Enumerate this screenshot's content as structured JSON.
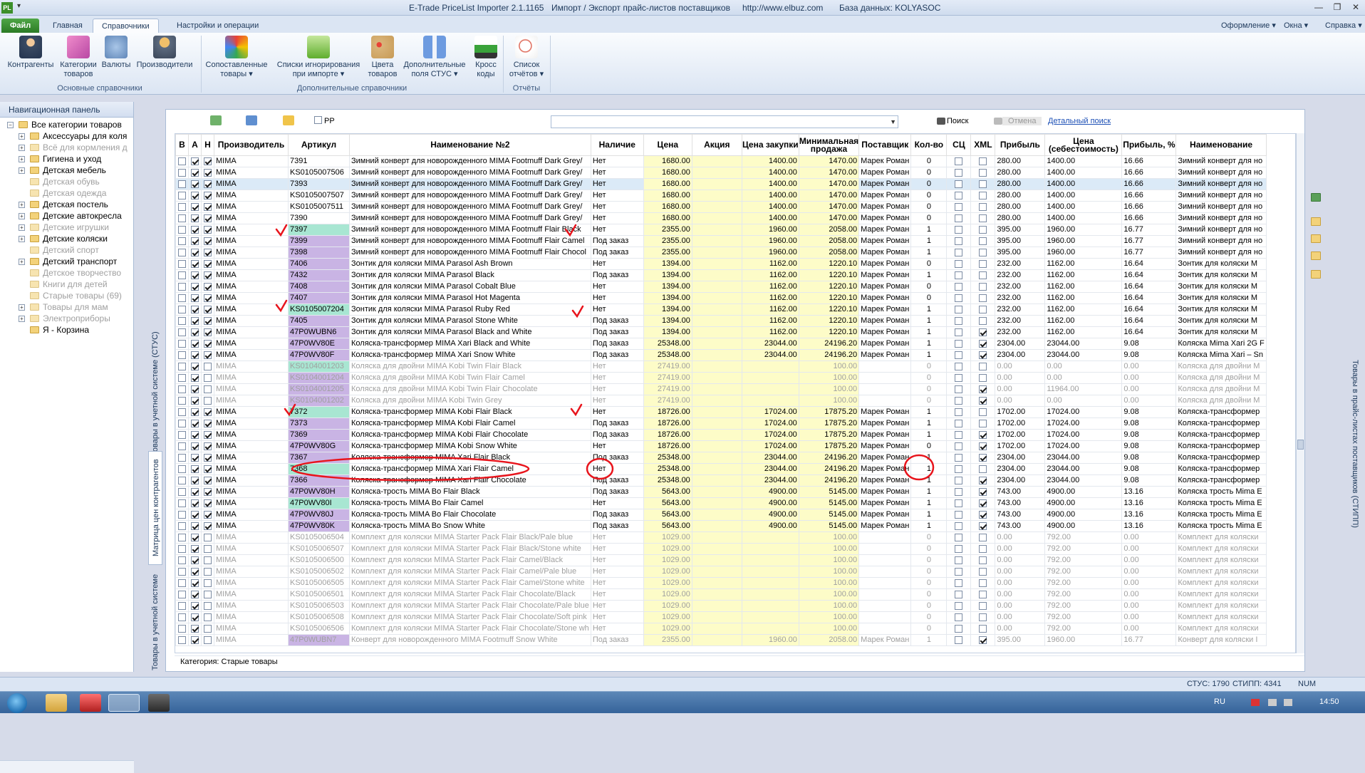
{
  "window": {
    "title": "E-Trade PriceList Importer 2.1.1165",
    "subtitle": "Импорт / Экспорт прайс-листов поставщиков",
    "url": "http://www.elbuz.com",
    "database": "База данных: KOLYASOC"
  },
  "ribbon_tabs": [
    "Файл",
    "Главная",
    "Справочники",
    "Настройки и операции"
  ],
  "ribbon_menus": [
    "Оформление",
    "Окна",
    "Справка"
  ],
  "ribbon_buttons": [
    {
      "label1": "Контрагенты",
      "label2": ""
    },
    {
      "label1": "Категории",
      "label2": "товаров"
    },
    {
      "label1": "Валюты",
      "label2": ""
    },
    {
      "label1": "Производители",
      "label2": ""
    },
    {
      "label1": "Сопоставленные",
      "label2": "товары"
    },
    {
      "label1": "Списки игнорирования",
      "label2": "при импорте"
    },
    {
      "label1": "Цвета",
      "label2": "товаров"
    },
    {
      "label1": "Дополнительные",
      "label2": "поля СТУС"
    },
    {
      "label1": "Кросс",
      "label2": "коды"
    },
    {
      "label1": "Список",
      "label2": "отчётов"
    }
  ],
  "ribbon_groups": [
    "Основные справочники",
    "Дополнительные справочники",
    "Отчёты"
  ],
  "nav": {
    "title": "Навигационная панель",
    "root": "Все категории товаров",
    "items": [
      {
        "label": "Аксессуары для коля",
        "dim": false,
        "exp": true
      },
      {
        "label": "Всё для кормления д",
        "dim": true,
        "exp": true
      },
      {
        "label": "Гигиена и уход",
        "dim": false,
        "exp": true
      },
      {
        "label": "Детская мебель",
        "dim": false,
        "exp": true
      },
      {
        "label": "Детская обувь",
        "dim": true,
        "exp": false
      },
      {
        "label": "Детская одежда",
        "dim": true,
        "exp": false
      },
      {
        "label": "Детская постель",
        "dim": false,
        "exp": true
      },
      {
        "label": "Детские автокресла",
        "dim": false,
        "exp": true
      },
      {
        "label": "Детские игрушки",
        "dim": true,
        "exp": true
      },
      {
        "label": "Детские коляски",
        "dim": false,
        "exp": true
      },
      {
        "label": "Детский спорт",
        "dim": true,
        "exp": false
      },
      {
        "label": "Детский транспорт",
        "dim": false,
        "exp": true
      },
      {
        "label": "Детское творчество",
        "dim": true,
        "exp": false
      },
      {
        "label": "Книги для детей",
        "dim": true,
        "exp": false
      },
      {
        "label": "Старые товары (69)",
        "dim": true,
        "exp": false
      },
      {
        "label": "Товары для мам",
        "dim": true,
        "exp": true
      },
      {
        "label": "Электроприборы",
        "dim": true,
        "exp": true
      },
      {
        "label": "Я - Корзина",
        "dim": false,
        "exp": false
      }
    ]
  },
  "side_tabs": [
    "Товары в учетной системе (СТУС)",
    "Матрица цен контрагентов",
    "Товары в учетной системе"
  ],
  "right_tab": "Товары в прайс-листах поставщиков (СТИПП)",
  "toolbar": {
    "pp": "PP",
    "search": "Поиск",
    "cancel": "Отмена",
    "advanced": "Детальный поиск"
  },
  "columns": [
    "В",
    "А",
    "Н",
    "Производитель",
    "Артикул",
    "Наименование №2",
    "Наличие",
    "Цена",
    "Акция",
    "Цена закупки",
    "Минимальная продажа",
    "Поставщик",
    "Кол-во",
    "СЦ",
    "XML",
    "Прибыль",
    "Цена (себестоимость)",
    "Прибыль, %",
    "Наименование"
  ],
  "rows": [
    [
      "MIMA",
      "7391",
      "",
      "Зимний конверт для новорожденного MIMA Footmuff Dark Grey/",
      "Нет",
      "1680.00",
      "1400.00",
      "1470.00",
      "Марек Роман",
      "0",
      false,
      "280.00",
      "1400.00",
      "16.66",
      "Зимний конверт для но",
      "",
      "n"
    ],
    [
      "MIMA",
      "KS0105007506",
      "",
      "Зимний конверт для новорожденного MIMA Footmuff Dark Grey/",
      "Нет",
      "1680.00",
      "1400.00",
      "1470.00",
      "Марек Роман",
      "0",
      false,
      "280.00",
      "1400.00",
      "16.66",
      "Зимний конверт для но",
      "",
      "n"
    ],
    [
      "MIMA",
      "7393",
      "",
      "Зимний конверт для новорожденного MIMA Footmuff Dark Grey/",
      "Нет",
      "1680.00",
      "1400.00",
      "1470.00",
      "Марек Роман",
      "0",
      false,
      "280.00",
      "1400.00",
      "16.66",
      "Зимний конверт для но",
      "",
      "s"
    ],
    [
      "MIMA",
      "KS0105007507",
      "",
      "Зимний конверт для новорожденного MIMA Footmuff Dark Grey/",
      "Нет",
      "1680.00",
      "1400.00",
      "1470.00",
      "Марек Роман",
      "0",
      false,
      "280.00",
      "1400.00",
      "16.66",
      "Зимний конверт для но",
      "",
      "n"
    ],
    [
      "MIMA",
      "KS0105007511",
      "",
      "Зимний конверт для новорожденного MIMA Footmuff Dark Grey/",
      "Нет",
      "1680.00",
      "1400.00",
      "1470.00",
      "Марек Роман",
      "0",
      false,
      "280.00",
      "1400.00",
      "16.66",
      "Зимний конверт для но",
      "",
      "n"
    ],
    [
      "MIMA",
      "7390",
      "",
      "Зимний конверт для новорожденного MIMA Footmuff Dark Grey/",
      "Нет",
      "1680.00",
      "1400.00",
      "1470.00",
      "Марек Роман",
      "0",
      false,
      "280.00",
      "1400.00",
      "16.66",
      "Зимний конверт для но",
      "",
      "n"
    ],
    [
      "MIMA",
      "7397",
      "t",
      "Зимний конверт для новорожденного MIMA Footmuff Flair Black",
      "Нет",
      "2355.00",
      "1960.00",
      "2058.00",
      "Марек Роман",
      "1",
      false,
      "395.00",
      "1960.00",
      "16.77",
      "Зимний конверт для но",
      "",
      "n"
    ],
    [
      "MIMA",
      "7399",
      "p",
      "Зимний конверт для новорожденного MIMA Footmuff Flair Camel",
      "Под заказ",
      "2355.00",
      "1960.00",
      "2058.00",
      "Марек Роман",
      "1",
      false,
      "395.00",
      "1960.00",
      "16.77",
      "Зимний конверт для но",
      "",
      "n"
    ],
    [
      "MIMA",
      "7398",
      "p",
      "Зимний конверт для новорожденного MIMA Footmuff Flair Chocol",
      "Под заказ",
      "2355.00",
      "1960.00",
      "2058.00",
      "Марек Роман",
      "1",
      false,
      "395.00",
      "1960.00",
      "16.77",
      "Зимний конверт для но",
      "",
      "n"
    ],
    [
      "MIMA",
      "7406",
      "p",
      "Зонтик для коляски MIMA Parasol Ash Brown",
      "Нет",
      "1394.00",
      "1162.00",
      "1220.10",
      "Марек Роман",
      "0",
      false,
      "232.00",
      "1162.00",
      "16.64",
      "Зонтик для коляски M",
      "",
      "n"
    ],
    [
      "MIMA",
      "7432",
      "p",
      "Зонтик для коляски MIMA Parasol Black",
      "Под заказ",
      "1394.00",
      "1162.00",
      "1220.10",
      "Марек Роман",
      "1",
      false,
      "232.00",
      "1162.00",
      "16.64",
      "Зонтик для коляски M",
      "",
      "n"
    ],
    [
      "MIMA",
      "7408",
      "p",
      "Зонтик для коляски MIMA Parasol Cobalt Blue",
      "Нет",
      "1394.00",
      "1162.00",
      "1220.10",
      "Марек Роман",
      "0",
      false,
      "232.00",
      "1162.00",
      "16.64",
      "Зонтик для коляски M",
      "",
      "n"
    ],
    [
      "MIMA",
      "7407",
      "p",
      "Зонтик для коляски MIMA Parasol Hot Magenta",
      "Нет",
      "1394.00",
      "1162.00",
      "1220.10",
      "Марек Роман",
      "0",
      false,
      "232.00",
      "1162.00",
      "16.64",
      "Зонтик для коляски M",
      "",
      "n"
    ],
    [
      "MIMA",
      "KS0105007204",
      "t",
      "Зонтик для коляски MIMA Parasol Ruby Red",
      "Нет",
      "1394.00",
      "1162.00",
      "1220.10",
      "Марек Роман",
      "1",
      false,
      "232.00",
      "1162.00",
      "16.64",
      "Зонтик для коляски M",
      "",
      "n"
    ],
    [
      "MIMA",
      "7405",
      "p",
      "Зонтик для коляски MIMA Parasol Stone White",
      "Под заказ",
      "1394.00",
      "1162.00",
      "1220.10",
      "Марек Роман",
      "1",
      false,
      "232.00",
      "1162.00",
      "16.64",
      "Зонтик для коляски M",
      "",
      "n"
    ],
    [
      "MIMA",
      "47P0WUBN6",
      "p",
      "Зонтик для коляски  MIMA Parasol Black and White",
      "Под заказ",
      "1394.00",
      "1162.00",
      "1220.10",
      "Марек Роман",
      "1",
      true,
      "232.00",
      "1162.00",
      "16.64",
      "Зонтик для коляски M",
      "",
      "n"
    ],
    [
      "MIMA",
      "47P0WV80E",
      "p",
      "Коляска-трансформер MIMA Xari Black and White",
      "Под заказ",
      "25348.00",
      "23044.00",
      "24196.20",
      "Марек Роман",
      "1",
      true,
      "2304.00",
      "23044.00",
      "9.08",
      "Коляска Mima Xari 2G F",
      "",
      "n"
    ],
    [
      "MIMA",
      "47P0WV80F",
      "p",
      "Коляска-трансформер MIMA Xari Snow White",
      "Под заказ",
      "25348.00",
      "23044.00",
      "24196.20",
      "Марек Роман",
      "1",
      true,
      "2304.00",
      "23044.00",
      "9.08",
      "Коляска Mima Xari – Sn",
      "",
      "n"
    ],
    [
      "MIMA",
      "KS0104001203",
      "t",
      "Коляска для двойни MIMA Kobi Twin Flair Black",
      "Нет",
      "27419.00",
      "",
      "100.00",
      "",
      "0",
      false,
      "0.00",
      "0.00",
      "0.00",
      "Коляска для двойни M",
      "",
      "d"
    ],
    [
      "MIMA",
      "KS0104001204",
      "p",
      "Коляска для двойни MIMA Kobi Twin Flair Camel",
      "Нет",
      "27419.00",
      "",
      "100.00",
      "",
      "0",
      false,
      "0.00",
      "0.00",
      "0.00",
      "Коляска для двойни M",
      "",
      "d"
    ],
    [
      "MIMA",
      "KS0104001205",
      "p",
      "Коляска для двойни MIMA Kobi Twin Flair Chocolate",
      "Нет",
      "27419.00",
      "",
      "100.00",
      "",
      "0",
      true,
      "0.00",
      "11964.00",
      "0.00",
      "Коляска для двойни M",
      "",
      "d"
    ],
    [
      "MIMA",
      "KS0104001202",
      "p",
      "Коляска для двойни MIMA Kobi Twin Grey",
      "Нет",
      "27419.00",
      "",
      "100.00",
      "",
      "0",
      true,
      "0.00",
      "0.00",
      "0.00",
      "Коляска для двойни M",
      "",
      "d"
    ],
    [
      "MIMA",
      "7372",
      "t",
      "Коляска-трансформер MIMA Kobi Flair Black",
      "Нет",
      "18726.00",
      "17024.00",
      "17875.20",
      "Марек Роман",
      "1",
      false,
      "1702.00",
      "17024.00",
      "9.08",
      "Коляска-трансформер",
      "",
      "n"
    ],
    [
      "MIMA",
      "7373",
      "p",
      "Коляска-трансформер MIMA Kobi Flair Camel",
      "Под заказ",
      "18726.00",
      "17024.00",
      "17875.20",
      "Марек Роман",
      "1",
      false,
      "1702.00",
      "17024.00",
      "9.08",
      "Коляска-трансформер",
      "",
      "n"
    ],
    [
      "MIMA",
      "7369",
      "p",
      "Коляска-трансформер MIMA Kobi Flair Chocolate",
      "Под заказ",
      "18726.00",
      "17024.00",
      "17875.20",
      "Марек Роман",
      "1",
      true,
      "1702.00",
      "17024.00",
      "9.08",
      "Коляска-трансформер",
      "",
      "n"
    ],
    [
      "MIMA",
      "47P0WV80G",
      "p",
      "Коляска-трансформер MIMA Kobi Snow White",
      "Нет",
      "18726.00",
      "17024.00",
      "17875.20",
      "Марек Роман",
      "0",
      true,
      "1702.00",
      "17024.00",
      "9.08",
      "Коляска-трансформер",
      "",
      "n"
    ],
    [
      "MIMA",
      "7367",
      "p",
      "Коляска-трансформер MIMA Xari Flair Black",
      "Под заказ",
      "25348.00",
      "23044.00",
      "24196.20",
      "Марек Роман",
      "1",
      true,
      "2304.00",
      "23044.00",
      "9.08",
      "Коляска-трансформер",
      "",
      "n"
    ],
    [
      "MIMA",
      "7368",
      "t",
      "Коляска-трансформер MIMA Xari Flair Camel",
      "Нет",
      "25348.00",
      "23044.00",
      "24196.20",
      "Марек Роман",
      "1",
      false,
      "2304.00",
      "23044.00",
      "9.08",
      "Коляска-трансформер",
      "",
      "n"
    ],
    [
      "MIMA",
      "7366",
      "p",
      "Коляска-трансформер MIMA Xari Flair Chocolate",
      "Под заказ",
      "25348.00",
      "23044.00",
      "24196.20",
      "Марек Роман",
      "1",
      true,
      "2304.00",
      "23044.00",
      "9.08",
      "Коляска-трансформер",
      "",
      "n"
    ],
    [
      "MIMA",
      "47P0WV80H",
      "p",
      "Коляска-трость MIMA Bo Flair Black",
      "Под заказ",
      "5643.00",
      "4900.00",
      "5145.00",
      "Марек Роман",
      "1",
      true,
      "743.00",
      "4900.00",
      "13.16",
      "Коляска трость Mima E",
      "",
      "n"
    ],
    [
      "MIMA",
      "47P0WV80I",
      "t",
      "Коляска-трость MIMA Bo Flair Camel",
      "Нет",
      "5643.00",
      "4900.00",
      "5145.00",
      "Марек Роман",
      "1",
      true,
      "743.00",
      "4900.00",
      "13.16",
      "Коляска трость Mima E",
      "",
      "n"
    ],
    [
      "MIMA",
      "47P0WV80J",
      "p",
      "Коляска-трость MIMA Bo Flair Chocolate",
      "Под заказ",
      "5643.00",
      "4900.00",
      "5145.00",
      "Марек Роман",
      "1",
      true,
      "743.00",
      "4900.00",
      "13.16",
      "Коляска трость Mima E",
      "",
      "n"
    ],
    [
      "MIMA",
      "47P0WV80K",
      "p",
      "Коляска-трость MIMA Bo Snow White",
      "Под заказ",
      "5643.00",
      "4900.00",
      "5145.00",
      "Марек Роман",
      "1",
      true,
      "743.00",
      "4900.00",
      "13.16",
      "Коляска трость Mima E",
      "",
      "n"
    ],
    [
      "MIMA",
      "KS0105006504",
      "",
      "Комплект для коляски MIMA Starter Pack Flair Black/Pale blue",
      "Нет",
      "1029.00",
      "",
      "100.00",
      "",
      "0",
      false,
      "0.00",
      "792.00",
      "0.00",
      "Комплект для коляски",
      "",
      "d"
    ],
    [
      "MIMA",
      "KS0105006507",
      "",
      "Комплект для коляски MIMA Starter Pack Flair Black/Stone white",
      "Нет",
      "1029.00",
      "",
      "100.00",
      "",
      "0",
      false,
      "0.00",
      "792.00",
      "0.00",
      "Комплект для коляски",
      "",
      "d"
    ],
    [
      "MIMA",
      "KS0105006500",
      "",
      "Комплект для коляски MIMA Starter Pack Flair Camel/Black",
      "Нет",
      "1029.00",
      "",
      "100.00",
      "",
      "0",
      false,
      "0.00",
      "792.00",
      "0.00",
      "Комплект для коляски",
      "",
      "d"
    ],
    [
      "MIMA",
      "KS0105006502",
      "",
      "Комплект для коляски MIMA Starter Pack Flair Camel/Pale blue",
      "Нет",
      "1029.00",
      "",
      "100.00",
      "",
      "0",
      false,
      "0.00",
      "792.00",
      "0.00",
      "Комплект для коляски",
      "",
      "d"
    ],
    [
      "MIMA",
      "KS0105006505",
      "",
      "Комплект для коляски MIMA Starter Pack Flair Camel/Stone white",
      "Нет",
      "1029.00",
      "",
      "100.00",
      "",
      "0",
      false,
      "0.00",
      "792.00",
      "0.00",
      "Комплект для коляски",
      "",
      "d"
    ],
    [
      "MIMA",
      "KS0105006501",
      "",
      "Комплект для коляски MIMA Starter Pack Flair Chocolate/Black",
      "Нет",
      "1029.00",
      "",
      "100.00",
      "",
      "0",
      false,
      "0.00",
      "792.00",
      "0.00",
      "Комплект для коляски",
      "",
      "d"
    ],
    [
      "MIMA",
      "KS0105006503",
      "",
      "Комплект для коляски MIMA Starter Pack Flair Chocolate/Pale blue",
      "Нет",
      "1029.00",
      "",
      "100.00",
      "",
      "0",
      false,
      "0.00",
      "792.00",
      "0.00",
      "Комплект для коляски",
      "",
      "d"
    ],
    [
      "MIMA",
      "KS0105006508",
      "",
      "Комплект для коляски MIMA Starter Pack Flair Chocolate/Soft pink",
      "Нет",
      "1029.00",
      "",
      "100.00",
      "",
      "0",
      false,
      "0.00",
      "792.00",
      "0.00",
      "Комплект для коляски",
      "",
      "d"
    ],
    [
      "MIMA",
      "KS0105006506",
      "",
      "Комплект для коляски MIMA Starter Pack Flair Chocolate/Stone wh",
      "Нет",
      "1029.00",
      "",
      "100.00",
      "",
      "0",
      false,
      "0.00",
      "792.00",
      "0.00",
      "Комплект для коляски",
      "",
      "d"
    ],
    [
      "MIMA",
      "47P0WUBN7",
      "p",
      "Конверт для новорожденного MIMA Footmuff Snow White",
      "Под заказ",
      "2355.00",
      "1960.00",
      "2058.00",
      "Марек Роман",
      "1",
      true,
      "395.00",
      "1960.00",
      "16.77",
      "Конверт для коляски I",
      "",
      "d"
    ]
  ],
  "footer": "Категория: Старые товары",
  "status": {
    "stus": "СТУС: 1790",
    "stipp": "СТИПП: 4341",
    "num": "NUM"
  },
  "taskbar": {
    "lang": "RU",
    "time": "14:50"
  },
  "colors": {
    "accent": "#2c7b25",
    "price_bg": "#fdfcc8",
    "article_purple": "#c9b4e4",
    "article_teal": "#a8e6d2",
    "annotation": "#e8141c"
  }
}
